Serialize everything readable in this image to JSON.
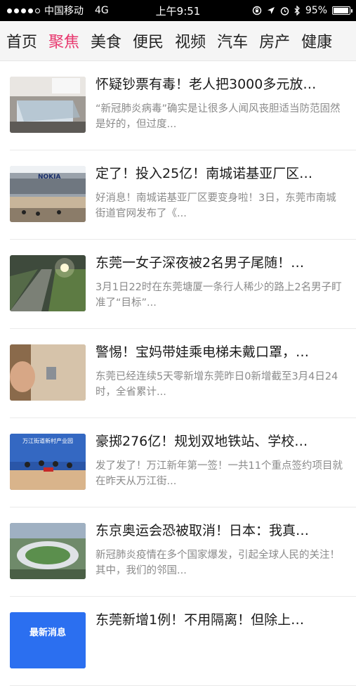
{
  "status": {
    "carrier": "中国移动",
    "network": "4G",
    "time": "上午9:51",
    "battery": "95%",
    "battery_level": 0.95
  },
  "tabs": [
    "首页",
    "聚焦",
    "美食",
    "便民",
    "视频",
    "汽车",
    "房产",
    "健康"
  ],
  "active_tab": 1,
  "articles": [
    {
      "title": "怀疑钞票有毒！老人把3000多元放…",
      "summary": "“新冠肺炎病毒”确实是让很多人闻风丧胆适当防范固然是好的，但过度..."
    },
    {
      "title": "定了！投入25亿！南城诺基亚厂区…",
      "summary": "好消息！南城诺基亚厂区要变身啦！3日，东莞市南城街道官网发布了《..."
    },
    {
      "title": "东莞一女子深夜被2名男子尾随！…",
      "summary": "3月1日22时在东莞塘厦一条行人稀少的路上2名男子盯准了“目标”..."
    },
    {
      "title": "警惕！宝妈带娃乘电梯未戴口罩，…",
      "summary": "东莞已经连续5天零新增东莞昨日0新增截至3月4日24时，全省累计..."
    },
    {
      "title": "豪掷276亿！规划双地铁站、学校…",
      "summary": "发了发了！万江新年第一签！一共11个重点签约项目就在昨天从万江街..."
    },
    {
      "title": "东京奥运会恐被取消！日本：我真…",
      "summary": "新冠肺炎疫情在多个国家爆发，引起全球人民的关注！其中，我们的邻国..."
    },
    {
      "title": "东莞新增1例！不用隔离！但除上…",
      "summary": ""
    }
  ],
  "thumb_text": {
    "nokia": "NOKIA",
    "wanjiang": "万江街道新村产业园",
    "last": "最新消息"
  },
  "colors": {
    "accent": "#e8376e"
  }
}
